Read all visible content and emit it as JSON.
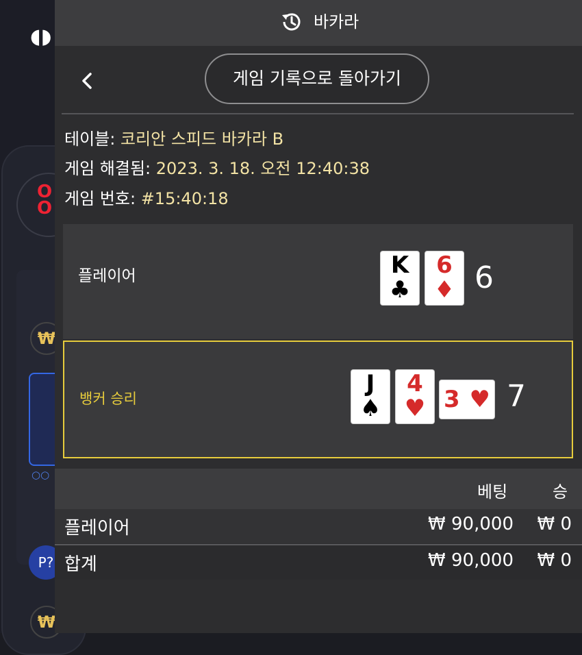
{
  "header": {
    "title": "바카라"
  },
  "nav": {
    "back_button_label": "게임 기록으로 돌아가기"
  },
  "info": {
    "table_label": "테이블:",
    "table_value": "코리안 스피드 바카라 B",
    "resolved_label": "게임 해결됨:",
    "resolved_value": "2023. 3. 18. 오전 12:40:38",
    "game_no_label": "게임 번호:",
    "game_no_value": "#15:40:18"
  },
  "player": {
    "label": "플레이어",
    "total": "6",
    "cards": [
      {
        "rank": "K",
        "suit": "♣",
        "color": "black"
      },
      {
        "rank": "6",
        "suit": "♦",
        "color": "red"
      }
    ]
  },
  "banker": {
    "label": "뱅커 승리",
    "total": "7",
    "cards": [
      {
        "rank": "J",
        "suit": "♠",
        "color": "black"
      },
      {
        "rank": "4",
        "suit": "♥",
        "color": "red"
      },
      {
        "rank": "3",
        "suit": "♥",
        "color": "red"
      }
    ]
  },
  "table": {
    "col_bet": "베팅",
    "col_win": "승",
    "rows": [
      {
        "label": "플레이어",
        "bet": "₩ 90,000",
        "win": "₩ 0"
      },
      {
        "label": "합계",
        "bet": "₩ 90,000",
        "win": "₩ 0"
      }
    ]
  },
  "background": {
    "won_symbol": "₩",
    "p_button": "P?"
  },
  "colors": {
    "highlight": "#e7cc3c",
    "value_text": "#f3e3a5",
    "panel_bg": "#2d2d2f",
    "card_red": "#d52a2a"
  }
}
